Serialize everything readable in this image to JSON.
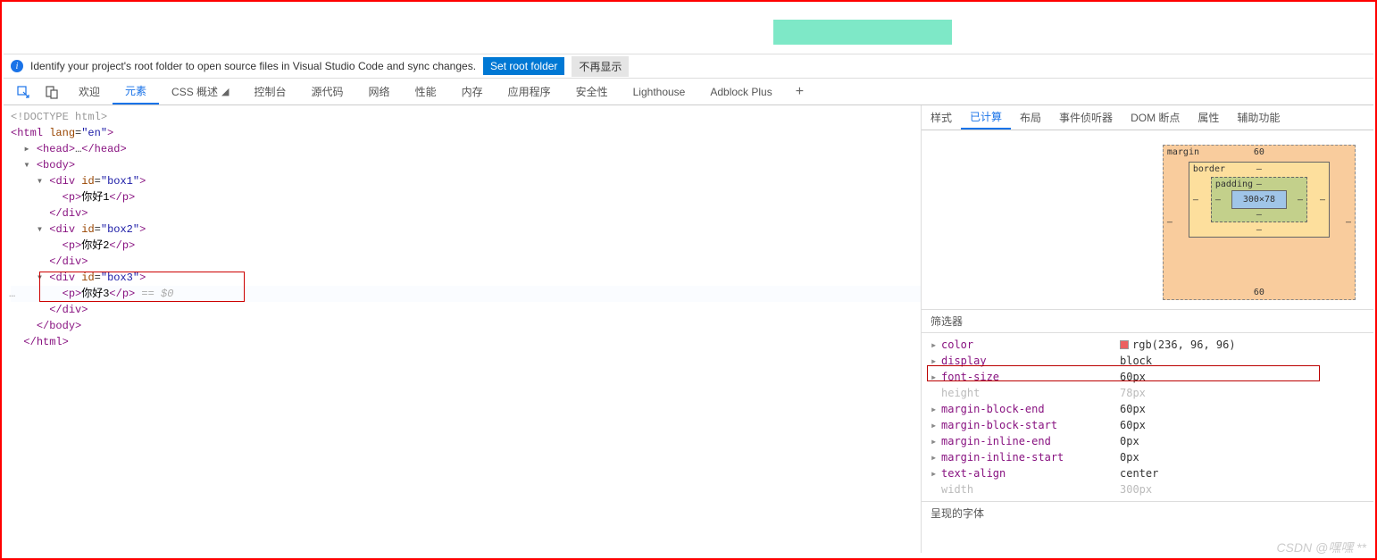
{
  "infobar": {
    "message": "Identify your project's root folder to open source files in Visual Studio Code and sync changes.",
    "set_folder": "Set root folder",
    "dismiss": "不再显示"
  },
  "tabs": {
    "welcome": "欢迎",
    "elements": "元素",
    "css_overview": "CSS 概述",
    "console": "控制台",
    "sources": "源代码",
    "network": "网络",
    "performance": "性能",
    "memory": "内存",
    "application": "应用程序",
    "security": "安全性",
    "lighthouse": "Lighthouse",
    "adblock": "Adblock Plus"
  },
  "dom": {
    "doctype": "<!DOCTYPE html>",
    "html_open": "<html lang=\"en\">",
    "head": "<head>…</head>",
    "body_open": "<body>",
    "box1_open": "<div id=\"box1\">",
    "p1": "你好1",
    "div_close": "</div>",
    "box2_open": "<div id=\"box2\">",
    "p2": "你好2",
    "box3_open": "<div id=\"box3\">",
    "p3": "你好3",
    "eq": " == $0",
    "body_close": "</body>",
    "html_close": "</html>"
  },
  "styles_tabs": {
    "styles": "样式",
    "computed": "已计算",
    "layout": "布局",
    "listeners": "事件侦听器",
    "dom_bp": "DOM 断点",
    "properties": "属性",
    "a11y": "辅助功能"
  },
  "boxmodel": {
    "margin_label": "margin",
    "border_label": "border",
    "padding_label": "padding",
    "margin_top": "60",
    "margin_bottom": "60",
    "border_val": "–",
    "padding_val": "–",
    "content": "300×78"
  },
  "filter_label": "筛选器",
  "computed": [
    {
      "name": "color",
      "value": "rgb(236, 96, 96)",
      "swatch": "#ec6060",
      "expandable": true
    },
    {
      "name": "display",
      "value": "block",
      "expandable": true
    },
    {
      "name": "font-size",
      "value": "60px",
      "expandable": true,
      "highlight": true
    },
    {
      "name": "height",
      "value": "78px",
      "dim": true,
      "expandable": false
    },
    {
      "name": "margin-block-end",
      "value": "60px",
      "expandable": true
    },
    {
      "name": "margin-block-start",
      "value": "60px",
      "expandable": true
    },
    {
      "name": "margin-inline-end",
      "value": "0px",
      "expandable": true
    },
    {
      "name": "margin-inline-start",
      "value": "0px",
      "expandable": true
    },
    {
      "name": "text-align",
      "value": "center",
      "expandable": true
    },
    {
      "name": "width",
      "value": "300px",
      "dim": true,
      "expandable": false
    }
  ],
  "fonts_label": "呈现的字体",
  "watermark": "CSDN @嘿嘿 **"
}
